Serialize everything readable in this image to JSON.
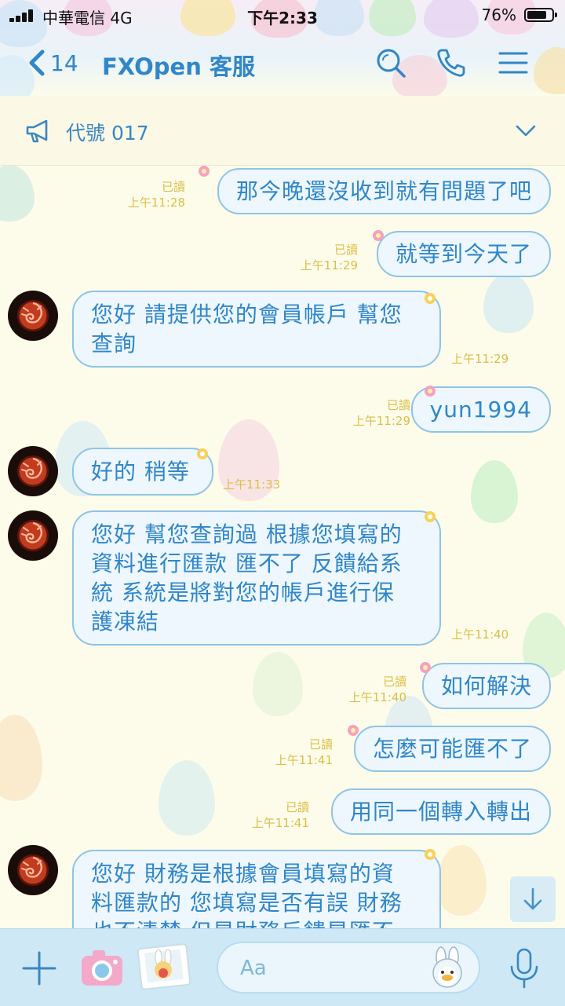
{
  "status_bar": {
    "carrier": "中華電信  4G",
    "time": "下午2:33",
    "battery": "76%"
  },
  "header": {
    "back_count": "14",
    "title": "FXOpen 客服"
  },
  "announcement": {
    "text": "代號 017"
  },
  "messages": [
    {
      "side": "out",
      "read": "已讀",
      "time": "上午11:28",
      "text": "那今晚還沒收到就有問題了吧"
    },
    {
      "side": "out",
      "read": "已讀",
      "time": "上午11:29",
      "text": "就等到今天了"
    },
    {
      "side": "in",
      "time": "上午11:29",
      "lines": [
        "您好 請提供您的會員帳戶 幫您",
        "查詢"
      ]
    },
    {
      "side": "out",
      "read": "已讀",
      "time": "上午11:29",
      "text": "yun1994"
    },
    {
      "side": "in",
      "time": "上午11:33",
      "lines": [
        "好的 稍等"
      ]
    },
    {
      "side": "in",
      "time": "上午11:40",
      "lines": [
        "您好 幫您查詢過 根據您填寫的",
        "資料進行匯款 匯不了 反饋給系",
        "統 系統是將對您的帳戶進行保",
        "護凍結"
      ]
    },
    {
      "side": "out",
      "read": "已讀",
      "time": "上午11:40",
      "text": "如何解決"
    },
    {
      "side": "out",
      "read": "已讀",
      "time": "上午11:41",
      "text": "怎麼可能匯不了"
    },
    {
      "side": "out",
      "read": "已讀",
      "time": "上午11:41",
      "text": "用同一個轉入轉出"
    },
    {
      "side": "in",
      "time": "",
      "lines": [
        "您好 財務是根據會員填寫的資",
        "料匯款的 您填寫是否有誤 財務",
        "也不清楚 但是財務反饋是匯不"
      ]
    }
  ],
  "composer": {
    "placeholder": "Aa"
  },
  "colors": {
    "accent": "#2f86c9",
    "bubble_border": "#8fc4e6",
    "bubble_fill": "#eef7fd",
    "meta": "#d9bf49",
    "bottom_bar": "#cfe8f6"
  },
  "icons": {
    "header": [
      "back-chevron-icon",
      "search-icon",
      "phone-icon",
      "menu-icon"
    ],
    "announcement": [
      "megaphone-icon",
      "chevron-down-icon"
    ],
    "bottom": [
      "plus-icon",
      "camera-icon",
      "photo-icon",
      "sticker-icon",
      "microphone-icon"
    ],
    "scroll": "arrow-down-icon"
  }
}
